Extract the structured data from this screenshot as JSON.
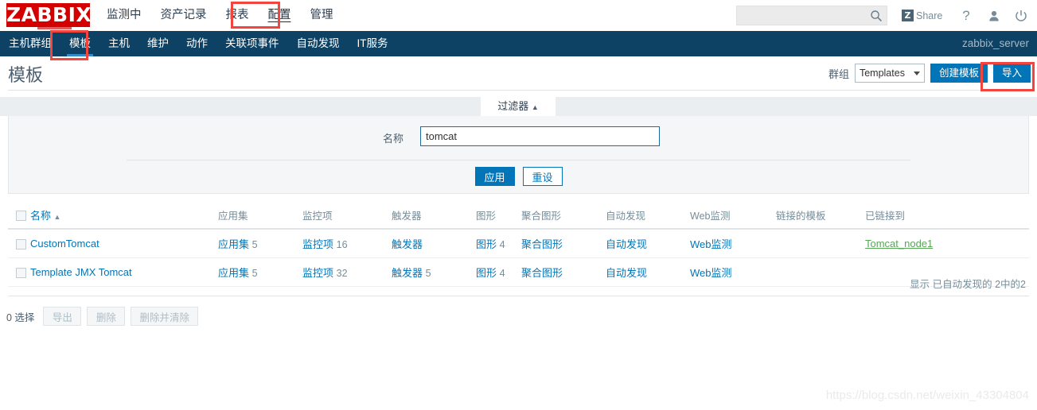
{
  "header": {
    "logo_text": "ZABBIX",
    "nav": [
      {
        "label": "监测中",
        "active": false
      },
      {
        "label": "资产记录",
        "active": false
      },
      {
        "label": "报表",
        "active": false
      },
      {
        "label": "配置",
        "active": true
      },
      {
        "label": "管理",
        "active": false
      }
    ],
    "search": {
      "value": "",
      "placeholder": "",
      "icon": "search-icon"
    },
    "share_label": "Share",
    "share_badge": "Z",
    "help_icon": "question-mark-icon",
    "user_icon": "user-icon",
    "signout_icon": "power-off-icon"
  },
  "subnav": {
    "items": [
      {
        "label": "主机群组",
        "selected": false
      },
      {
        "label": "模板",
        "selected": true
      },
      {
        "label": "主机",
        "selected": false
      },
      {
        "label": "维护",
        "selected": false
      },
      {
        "label": "动作",
        "selected": false
      },
      {
        "label": "关联项事件",
        "selected": false
      },
      {
        "label": "自动发现",
        "selected": false
      },
      {
        "label": "IT服务",
        "selected": false
      }
    ],
    "server_name": "zabbix_server"
  },
  "title_row": {
    "page_title": "模板",
    "group_label": "群组",
    "group_selected": "Templates",
    "create_button": "创建模板",
    "import_button": "导入"
  },
  "filter": {
    "tab_label": "过滤器",
    "tab_caret": "▲",
    "name_label": "名称",
    "name_value": "tomcat",
    "name_placeholder": "",
    "apply_button": "应用",
    "reset_button": "重设"
  },
  "table": {
    "columns": [
      "名称",
      "应用集",
      "监控项",
      "触发器",
      "图形",
      "聚合图形",
      "自动发现",
      "Web监测",
      "链接的模板",
      "已链接到"
    ],
    "sort_column_index": 0,
    "sort_arrow": "▲",
    "rows": [
      {
        "name": "CustomTomcat",
        "applications": {
          "label": "应用集",
          "count": "5"
        },
        "items": {
          "label": "监控项",
          "count": "16"
        },
        "triggers": {
          "label": "触发器",
          "count": ""
        },
        "graphs": {
          "label": "图形",
          "count": "4"
        },
        "screens": {
          "label": "聚合图形",
          "count": ""
        },
        "discovery": {
          "label": "自动发现",
          "count": ""
        },
        "web": {
          "label": "Web监测",
          "count": ""
        },
        "linked_templates": "",
        "linked_to": "Tomcat_node1"
      },
      {
        "name": "Template JMX Tomcat",
        "applications": {
          "label": "应用集",
          "count": "5"
        },
        "items": {
          "label": "监控项",
          "count": "32"
        },
        "triggers": {
          "label": "触发器",
          "count": "5"
        },
        "graphs": {
          "label": "图形",
          "count": "4"
        },
        "screens": {
          "label": "聚合图形",
          "count": ""
        },
        "discovery": {
          "label": "自动发现",
          "count": ""
        },
        "web": {
          "label": "Web监测",
          "count": ""
        },
        "linked_templates": "",
        "linked_to": ""
      }
    ],
    "footer_count": "显示 已自动发现的 2中的2"
  },
  "actions": {
    "selected_text": "0 选择",
    "export_button": "导出",
    "delete_button": "删除",
    "delete_clear_button": "删除并清除"
  },
  "watermark": "https://blog.csdn.net/weixin_43304804",
  "colors": {
    "brand_red": "#D40000",
    "navy": "#0E4264",
    "accent_blue": "#0275b8",
    "highlight_red": "#F2453D",
    "link_green": "#59a659"
  }
}
